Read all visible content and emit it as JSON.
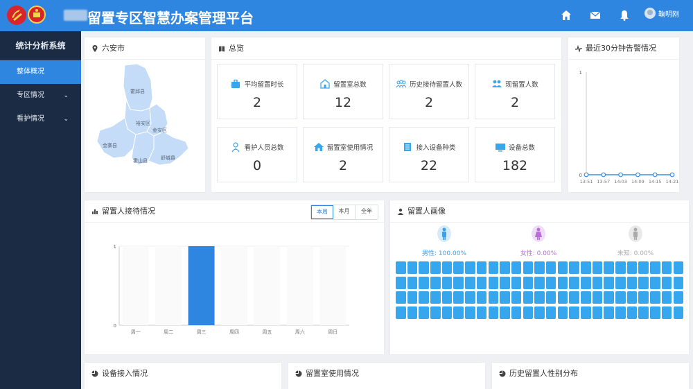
{
  "header": {
    "title": "留置专区智慧办案管理平台",
    "user_name": "鞠明刚"
  },
  "sidebar": {
    "title": "统计分析系统",
    "items": [
      {
        "label": "整体概况",
        "active": true
      },
      {
        "label": "专区情况",
        "has_children": true
      },
      {
        "label": "看护情况",
        "has_children": true
      }
    ]
  },
  "map_panel": {
    "title": "六安市",
    "regions": [
      "霍邱县",
      "裕安区",
      "金安区",
      "金寨县",
      "霍山县",
      "舒城县"
    ]
  },
  "overview": {
    "title": "总览",
    "cards": [
      {
        "label": "平均留置时长",
        "value": "2",
        "icon": "briefcase-icon"
      },
      {
        "label": "留置室总数",
        "value": "12",
        "icon": "building-icon"
      },
      {
        "label": "历史接待留置人数",
        "value": "2",
        "icon": "group-icon"
      },
      {
        "label": "现留置人数",
        "value": "2",
        "icon": "users-icon"
      },
      {
        "label": "看护人员总数",
        "value": "0",
        "icon": "nurse-icon"
      },
      {
        "label": "留置室使用情况",
        "value": "2",
        "icon": "home-icon"
      },
      {
        "label": "接入设备种类",
        "value": "22",
        "icon": "list-icon"
      },
      {
        "label": "设备总数",
        "value": "182",
        "icon": "monitor-icon"
      }
    ]
  },
  "alarm_panel": {
    "title": "最近30分钟告警情况",
    "chart_data": {
      "type": "line",
      "x": [
        "13:51",
        "13:57",
        "14:03",
        "14:09",
        "14:15",
        "14:21"
      ],
      "series": [
        {
          "values": [
            0,
            0,
            0,
            0,
            0,
            0
          ]
        }
      ],
      "ylim": [
        0,
        1
      ],
      "yticks": [
        "0",
        "1"
      ]
    }
  },
  "reception_panel": {
    "title": "留置人接待情况",
    "ranges": [
      "本周",
      "本月",
      "全年"
    ],
    "active_range": "本周",
    "chart_data": {
      "type": "bar",
      "categories": [
        "周一",
        "周二",
        "周三",
        "周四",
        "周五",
        "周六",
        "周日"
      ],
      "values": [
        0,
        0,
        1,
        0,
        0,
        0,
        0
      ],
      "ylim": [
        0,
        1
      ],
      "yticks": [
        "0",
        "1"
      ],
      "color": "#2f86e0"
    }
  },
  "portrait_panel": {
    "title": "留置人画像",
    "genders": [
      {
        "label": "男性: 100.00%",
        "color": "#3aa0e8"
      },
      {
        "label": "女性: 0.00%",
        "color": "#b86fd6"
      },
      {
        "label": "未知: 0.00%",
        "color": "#aaaaaa"
      }
    ],
    "grid": {
      "rows": 4,
      "cols": 25,
      "color": "#36a6ee"
    }
  },
  "bottom_panels": [
    {
      "title": "设备接入情况"
    },
    {
      "title": "留置室使用情况"
    },
    {
      "title": "历史留置人性别分布"
    }
  ]
}
